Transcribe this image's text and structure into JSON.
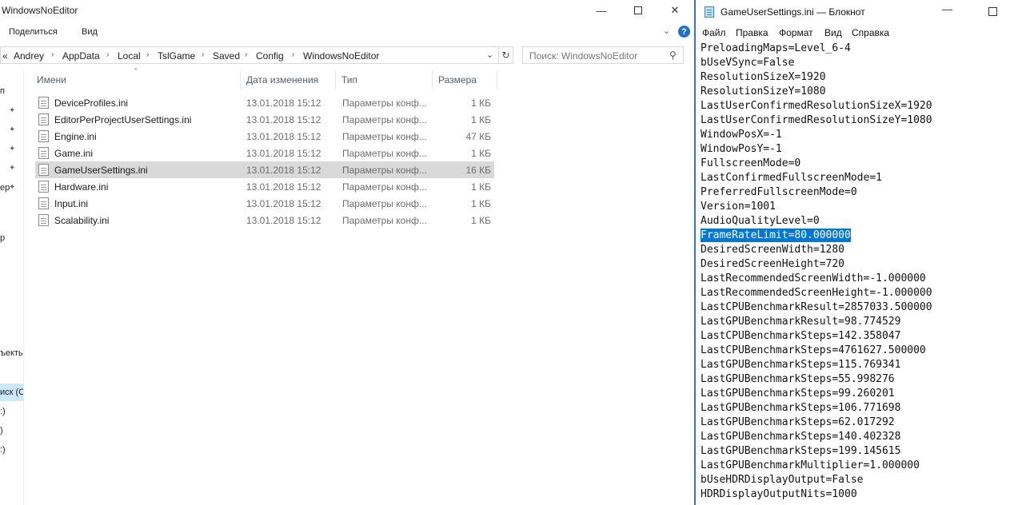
{
  "explorer": {
    "title": "WindowsNoEditor",
    "ribbon": {
      "share": "Поделиться",
      "view": "Вид"
    },
    "address": {
      "overflow": "«",
      "crumbs": [
        "Andrey",
        "AppData",
        "Local",
        "TslGame",
        "Saved",
        "Config",
        "WindowsNoEditor"
      ]
    },
    "search": {
      "placeholder": "Поиск: WindowsNoEditor"
    },
    "nav_fragments": [
      "п",
      "ер",
      "р",
      "ъекты",
      "иск (С",
      ":)",
      ")",
      ":)"
    ],
    "columns": {
      "name": "Имени",
      "date": "Дата изменения",
      "type": "Тип",
      "size": "Размера"
    },
    "files": [
      {
        "name": "DeviceProfiles.ini",
        "date": "13.01.2018 15:12",
        "type": "Параметры конф...",
        "size": "1 КБ"
      },
      {
        "name": "EditorPerProjectUserSettings.ini",
        "date": "13.01.2018 15:12",
        "type": "Параметры конф...",
        "size": "1 КБ"
      },
      {
        "name": "Engine.ini",
        "date": "13.01.2018 15:12",
        "type": "Параметры конф...",
        "size": "47 КБ"
      },
      {
        "name": "Game.ini",
        "date": "13.01.2018 15:12",
        "type": "Параметры конф...",
        "size": "1 КБ"
      },
      {
        "name": "GameUserSettings.ini",
        "date": "13.01.2018 15:12",
        "type": "Параметры конф...",
        "size": "16 КБ",
        "selected": true
      },
      {
        "name": "Hardware.ini",
        "date": "13.01.2018 15:12",
        "type": "Параметры конф...",
        "size": "1 КБ"
      },
      {
        "name": "Input.ini",
        "date": "13.01.2018 15:12",
        "type": "Параметры конф...",
        "size": "1 КБ"
      },
      {
        "name": "Scalability.ini",
        "date": "13.01.2018 15:12",
        "type": "Параметры конф...",
        "size": "1 КБ"
      }
    ]
  },
  "notepad": {
    "title": "GameUserSettings.ini — Блокнот",
    "menu": [
      "Файл",
      "Правка",
      "Формат",
      "Вид",
      "Справка"
    ],
    "highlight_color": "#0078d7",
    "selected_line": "FrameRateLimit=80.000000",
    "lines": [
      "PreloadingMaps=Level_6-4",
      "bUseVSync=False",
      "ResolutionSizeX=1920",
      "ResolutionSizeY=1080",
      "LastUserConfirmedResolutionSizeX=1920",
      "LastUserConfirmedResolutionSizeY=1080",
      "WindowPosX=-1",
      "WindowPosY=-1",
      "FullscreenMode=0",
      "LastConfirmedFullscreenMode=1",
      "PreferredFullscreenMode=0",
      "Version=1001",
      "AudioQualityLevel=0",
      "FrameRateLimit=80.000000",
      "DesiredScreenWidth=1280",
      "DesiredScreenHeight=720",
      "LastRecommendedScreenWidth=-1.000000",
      "LastRecommendedScreenHeight=-1.000000",
      "LastCPUBenchmarkResult=2857033.500000",
      "LastGPUBenchmarkResult=98.774529",
      "LastCPUBenchmarkSteps=142.358047",
      "LastCPUBenchmarkSteps=4761627.500000",
      "LastGPUBenchmarkSteps=115.769341",
      "LastGPUBenchmarkSteps=55.998276",
      "LastGPUBenchmarkSteps=99.260201",
      "LastGPUBenchmarkSteps=106.771698",
      "LastGPUBenchmarkSteps=62.017292",
      "LastGPUBenchmarkSteps=140.402328",
      "LastGPUBenchmarkSteps=199.145615",
      "LastGPUBenchmarkMultiplier=1.000000",
      "bUseHDRDisplayOutput=False",
      "HDRDisplayOutputNits=1000"
    ]
  }
}
